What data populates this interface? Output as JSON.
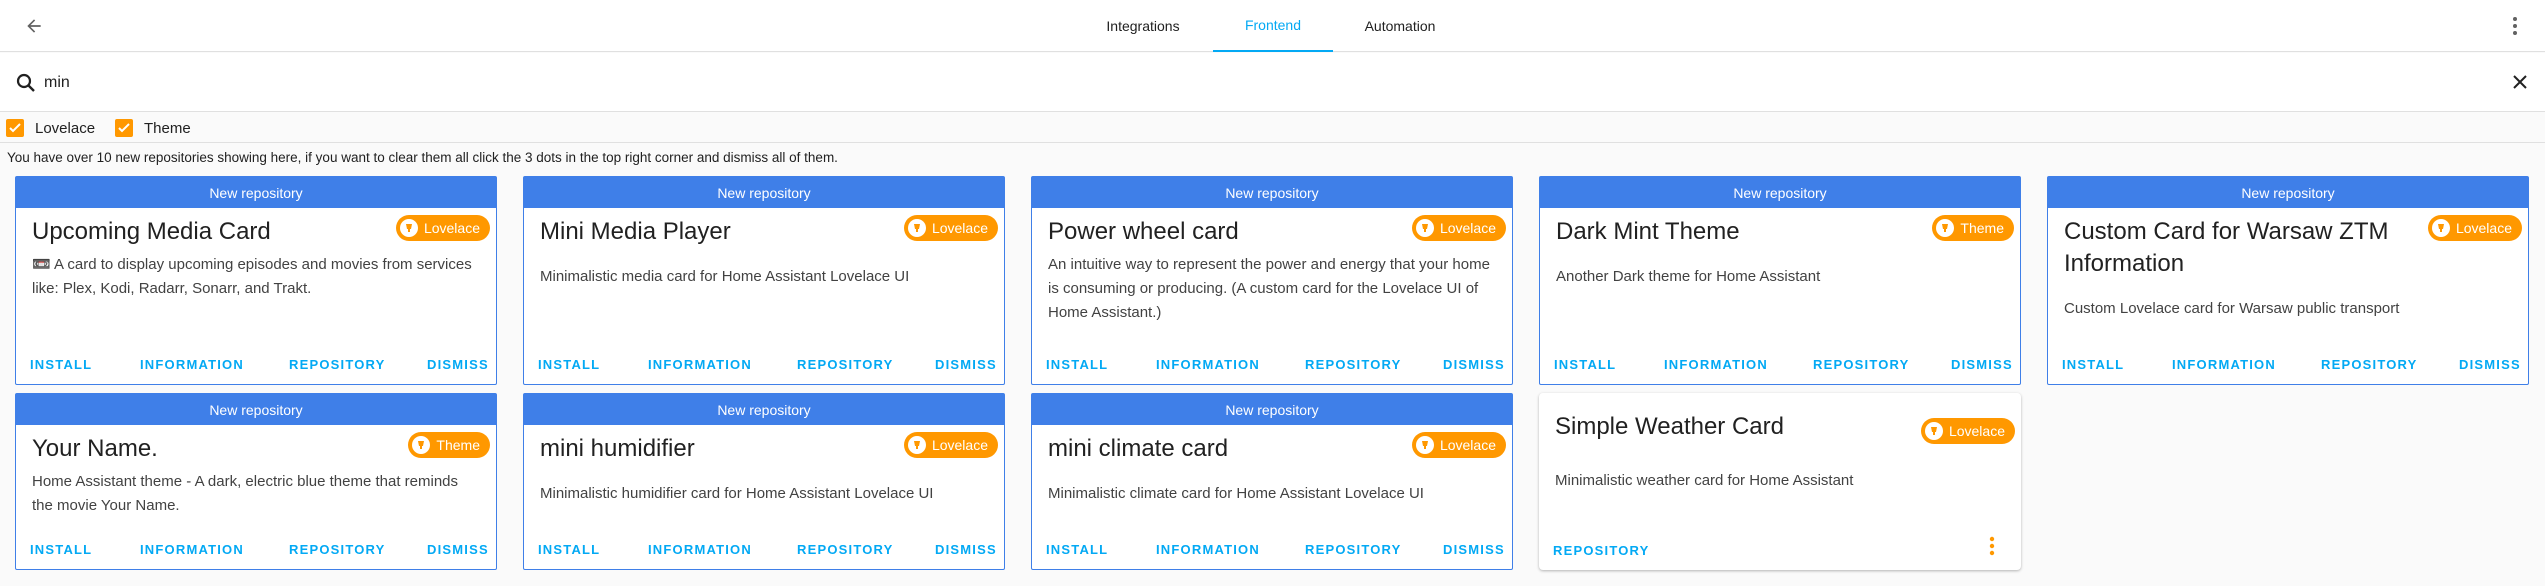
{
  "tabs": [
    {
      "label": "Integrations"
    },
    {
      "label": "Frontend"
    },
    {
      "label": "Automation"
    }
  ],
  "search": {
    "value": "min"
  },
  "filters": [
    {
      "label": "Lovelace",
      "checked": true
    },
    {
      "label": "Theme",
      "checked": true
    }
  ],
  "notice": "You have over 10 new repositories showing here, if you want to clear them all click the 3 dots in the top right corner and dismiss all of them.",
  "colors": {
    "accent": "#03a9f4",
    "header_blue": "#3f7fe8",
    "badge_orange": "#ff9800"
  },
  "new_repo_label": "New repository",
  "actions": {
    "install": "INSTALL",
    "information": "INFORMATION",
    "repository": "REPOSITORY",
    "dismiss": "DISMISS"
  },
  "cards": [
    {
      "title": "Upcoming Media Card",
      "badge": "Lovelace",
      "emoji": "📼",
      "description": "A card to display upcoming episodes and movies from services like: Plex, Kodi, Radarr, Sonarr, and Trakt."
    },
    {
      "title": "Mini Media Player",
      "badge": "Lovelace",
      "description": "Minimalistic media card for Home Assistant Lovelace UI"
    },
    {
      "title": "Power wheel card",
      "badge": "Lovelace",
      "description": "An intuitive way to represent the power and energy that your home is consuming or producing. (A custom card for the Lovelace UI of Home Assistant.)"
    },
    {
      "title": "Dark Mint Theme",
      "badge": "Theme",
      "description": "Another Dark theme for Home Assistant"
    },
    {
      "title": "Custom Card for Warsaw ZTM Information",
      "badge": "Lovelace",
      "description": "Custom Lovelace card for Warsaw public transport"
    },
    {
      "title": "Your Name.",
      "badge": "Theme",
      "description": "Home Assistant theme - A dark, electric blue theme that reminds the movie Your Name."
    },
    {
      "title": "mini humidifier",
      "badge": "Lovelace",
      "description": "Minimalistic humidifier card for Home Assistant Lovelace UI"
    },
    {
      "title": "mini climate card",
      "badge": "Lovelace",
      "description": "Minimalistic climate card for Home Assistant Lovelace UI"
    },
    {
      "title": "Simple Weather Card",
      "badge": "Lovelace",
      "description": "Minimalistic weather card for Home Assistant"
    }
  ]
}
